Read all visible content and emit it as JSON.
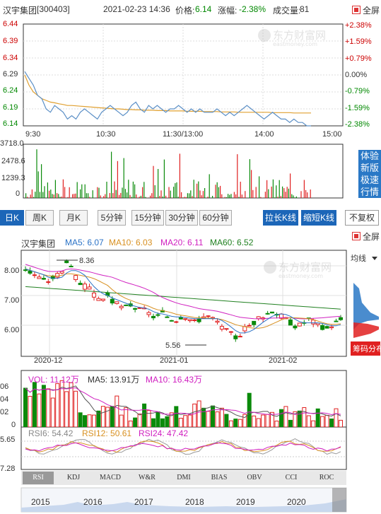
{
  "header": {
    "stock_name": "汉宇集团",
    "stock_code": "[300403]",
    "datetime": "2021-02-23 14:36",
    "price_label": "价格:",
    "price": "6.14",
    "change_label": "涨幅:",
    "change": "-2.38%",
    "volume_label": "成交量:",
    "volume": "81",
    "fullscreen_label": "全屏"
  },
  "watermark": {
    "brand": "东方财富网",
    "domain": "eastmoney.com"
  },
  "intraday": {
    "price_axis": [
      "6.44",
      "6.39",
      "6.34",
      "6.29",
      "6.24",
      "6.19",
      "6.14"
    ],
    "pct_axis": [
      "+2.38%",
      "+1.59%",
      "+0.79%",
      "0.00%",
      "-0.79%",
      "-1.59%",
      "-2.38%"
    ],
    "time_axis": [
      "9:30",
      "10:30",
      "11:30/13:00",
      "14:00",
      "15:00"
    ],
    "volume_axis": [
      "3718.0",
      "2478.6",
      "1239.3",
      "0"
    ],
    "price_series": [
      6.3,
      6.28,
      6.26,
      6.23,
      6.22,
      6.19,
      6.18,
      6.2,
      6.19,
      6.18,
      6.16,
      6.17,
      6.16,
      6.18,
      6.19,
      6.18,
      6.17,
      6.16,
      6.18,
      6.19,
      6.2,
      6.19,
      6.18,
      6.17,
      6.18,
      6.2,
      6.21,
      6.19,
      6.18,
      6.2,
      6.19,
      6.2,
      6.19,
      6.18,
      6.19,
      6.19,
      6.2,
      6.19,
      6.18,
      6.19,
      6.18,
      6.19,
      6.18,
      6.18,
      6.18,
      6.19,
      6.18,
      6.17,
      6.18,
      6.17,
      6.18,
      6.19,
      6.2,
      6.19,
      6.18,
      6.17,
      6.16,
      6.17,
      6.18,
      6.17,
      6.16,
      6.16,
      6.15,
      6.16,
      6.15,
      6.15,
      6.14,
      6.14
    ],
    "avg_series": [
      6.29,
      6.26,
      6.24,
      6.23,
      6.22,
      6.215,
      6.21,
      6.208,
      6.205,
      6.203,
      6.2,
      6.2,
      6.199,
      6.198,
      6.197,
      6.196,
      6.195,
      6.194,
      6.193,
      6.192,
      6.191,
      6.19,
      6.19,
      6.189,
      6.188,
      6.188,
      6.187,
      6.187,
      6.186,
      6.186,
      6.186,
      6.185,
      6.185,
      6.185,
      6.184,
      6.184,
      6.184,
      6.184,
      6.183,
      6.183,
      6.183,
      6.183,
      6.182,
      6.182,
      6.182,
      6.182,
      6.181,
      6.181,
      6.181,
      6.181,
      6.18,
      6.18,
      6.18,
      6.18,
      6.18,
      6.18,
      6.18,
      6.18,
      6.179,
      6.179,
      6.179,
      6.179,
      6.179,
      6.178,
      6.178,
      6.178,
      6.178,
      6.178
    ]
  },
  "sidead": [
    "体验",
    "新版",
    "极速",
    "行情"
  ],
  "tabs": [
    "日K",
    "周K",
    "月K",
    "5分钟",
    "15分钟",
    "30分钟",
    "60分钟"
  ],
  "actions": {
    "stretch": "拉长K线",
    "shrink": "缩短K线",
    "adjust": "不复权"
  },
  "kline": {
    "fullscreen_label": "全屏",
    "name": "汉宇集团",
    "ma5": "MA5: 6.07",
    "ma10": "MA10: 6.03",
    "ma20": "MA20: 6.11",
    "ma60": "MA60: 6.52",
    "price_axis": [
      "8.00",
      "7.00",
      "6.00"
    ],
    "date_axis": [
      "2020-12",
      "2021-01",
      "2021-02"
    ],
    "high_label": "8.36",
    "low_label": "5.56",
    "chip_label": "均线",
    "chip_button": "筹码分布"
  },
  "volume_panel": {
    "vol": "VOL: 11.12万",
    "ma5": "MA5: 13.91万",
    "ma10": "MA10: 16.43万",
    "axis": [
      "06",
      "04",
      "02",
      "0"
    ]
  },
  "rsi_panel": {
    "rsi6": "RSI6: 54.42",
    "rsi12": "RSI12: 50.61",
    "rsi24": "RSI24: 47.42",
    "axis": [
      "5.65",
      "7.28"
    ]
  },
  "indicator_tabs": [
    "RSI",
    "KDJ",
    "MACD",
    "W&R",
    "DMI",
    "BIAS",
    "OBV",
    "CCI",
    "ROC"
  ],
  "years": [
    "2015",
    "2016",
    "2017",
    "2018",
    "2019",
    "2020"
  ],
  "colors": {
    "up": "#e02020",
    "down": "#0a8a0a",
    "accent": "#1c66b8",
    "price_line": "#5b8fc6",
    "avg_line": "#e0a030"
  }
}
